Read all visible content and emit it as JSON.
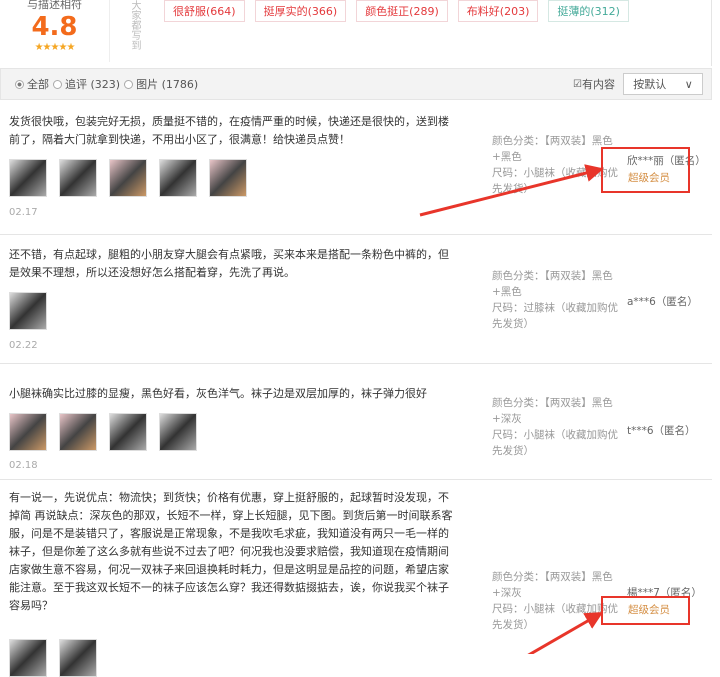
{
  "summary": {
    "label": "与描述相符",
    "score": "4.8",
    "stars": "★★★★★",
    "vertical_label": "大家都写到"
  },
  "tags": [
    {
      "label": "很舒服(664)"
    },
    {
      "label": "挺厚实的(366)"
    },
    {
      "label": "颜色挺正(289)"
    },
    {
      "label": "布料好(203)"
    },
    {
      "label": "挺薄的(312)"
    }
  ],
  "filter": {
    "all": "全部",
    "append": "追评 (323)",
    "pictures": "图片 (1786)",
    "has_content": "有内容",
    "sort": "按默认",
    "sort_chevron": "∨"
  },
  "reviews": [
    {
      "text": "发货很快哦，包装完好无损，质量挺不错的，在疫情严重的时候，快递还是很快的，送到楼前了，隔着大门就拿到快递，不用出小区了，很满意！给快递员点赞！",
      "date": "02.17",
      "sku_color": "颜色分类：【两双装】黑色+黑色",
      "sku_size": "尺码：小腿袜（收藏加购优先发货）",
      "user": "欣***丽（匿名）",
      "badge": "超级会员"
    },
    {
      "text": "还不错，有点起球，腿粗的小朋友穿大腿会有点紧哦，买来本来是搭配一条粉色中裤的，但是效果不理想，所以还没想好怎么搭配着穿，先洗了再说。",
      "date": "02.22",
      "sku_color": "颜色分类：【两双装】黑色+黑色",
      "sku_size": "尺码：过膝袜（收藏加购优先发货）",
      "user": "a***6（匿名）"
    },
    {
      "text": "小腿袜确实比过膝的显瘦，黑色好看，灰色洋气。袜子边是双层加厚的，袜子弹力很好",
      "date": "02.18",
      "sku_color": "颜色分类：【两双装】黑色+深灰",
      "sku_size": "尺码：小腿袜（收藏加购优先发货）",
      "user": "t***6（匿名）"
    },
    {
      "text": "有一说一，先说优点：物流快；到货快；价格有优惠，穿上挺舒服的，起球暂时没发现，不掉简 再说缺点：深灰色的那双，长短不一样，穿上长短腿，见下图。到货后第一时间联系客服，问是不是装错只了，客服说是正常现象，不是我吹毛求疵，我知道没有两只一毛一样的袜子，但是你差了这么多就有些说不过去了吧？何况我也没要求赔偿，我知道现在疫情期间店家做生意不容易，何况一双袜子来回退换耗时耗力，但是这明显是品控的问题，希望店家能注意。至于我这双长短不一的袜子应该怎么穿？我还得数掂掇掂去，诶，你说我买个袜子容易吗？",
      "sku_color": "颜色分类：【两双装】黑色+深灰",
      "sku_size": "尺码：小腿袜（收藏加购优先发货）",
      "user": "楊***7（匿名）",
      "badge": "超级会员"
    }
  ],
  "colors": {
    "accent": "#f36b1c",
    "highlight": "#e8352a",
    "vip": "#d59046"
  }
}
